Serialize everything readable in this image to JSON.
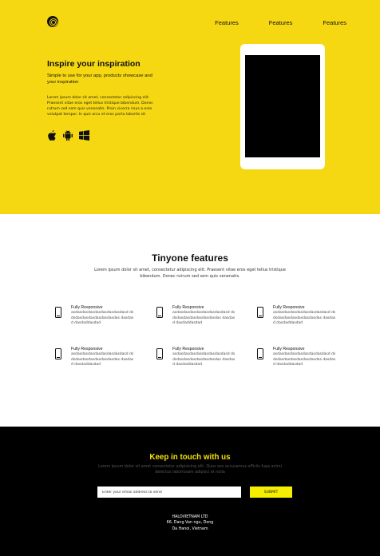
{
  "colors": {
    "accent": "#f6d812",
    "footer_bg": "#000000",
    "footer_title": "#f6e20c",
    "submit_bg": "#f6ee00"
  },
  "header": {
    "logo_icon": "fingerprint-icon",
    "nav": [
      "Features",
      "Features",
      "Features"
    ]
  },
  "hero": {
    "title": "Inspire your inspiration",
    "subtitle": "Simple to use for your app, products showcase and your inspiration",
    "body": "Lorem ipsum dolor sit amet, consectetur adipiscing elit. Praesent vitae eros eget tellus tristique bibendum. Donec rutrum sed sem quis venenatis. Proin viverra risus a eros volutpat tempor. In quis arcu et eros porta lobortis sit",
    "platform_icons": [
      "apple-icon",
      "android-icon",
      "windows-icon"
    ]
  },
  "features": {
    "title": "Tinyone features",
    "description": "Lorem ipsum dolor sit amet, consectetur adipiscing elit. Praesent vitae eros eget tellus tristique bibendum. Donec rutrum sed sem quis venenatis.",
    "items": [
      {
        "title": "Fully Responsive",
        "text": "asdasdasdasdasdasdasdasdasd dsdsdasdasdasdasdasdasdas dasdasd dasdaddasdad"
      },
      {
        "title": "Fully Responsive",
        "text": "asdasdasdasdasdasdasdasdasd dsdsdasdasdasdasdasdasdas dasdasd dasdaddasdad"
      },
      {
        "title": "Fully Responsive",
        "text": "asdasdasdasdasdasdasdasdasd dsdsdasdasdasdasdasdasdas dasdasd dasdaddasdad"
      },
      {
        "title": "Fully Responsive",
        "text": "asdasdasdasdasdasdasdasdasd dsdsdasdasdasdasdasdasdas dasdasd dasdaddasdad"
      },
      {
        "title": "Fully Responsive",
        "text": "asdasdasdasdasdasdasdasdasd dsdsdasdasdasdasdasdasdas dasdasd dasdaddasdad"
      },
      {
        "title": "Fully Responsive",
        "text": "asdasdasdasdasdasdasdasdasd dsdsdasdasdasdasdasdasdas dasdasd dasdaddasdad"
      }
    ]
  },
  "contact": {
    "title": "Keep in touch with us",
    "description": "Lorem ipsum dolor sit amet consectetur adipisicing elit. Quos eos accusamus officiis fuga animi delectus laboriosam adipisci et nulla",
    "email_placeholder": "Enter your email address to send",
    "submit_label": "SUBMIT",
    "address": [
      "HALOVIETNAM LTD",
      "66, Dang Van ngu, Dong",
      "Da Hanoi, Vietnam"
    ]
  }
}
